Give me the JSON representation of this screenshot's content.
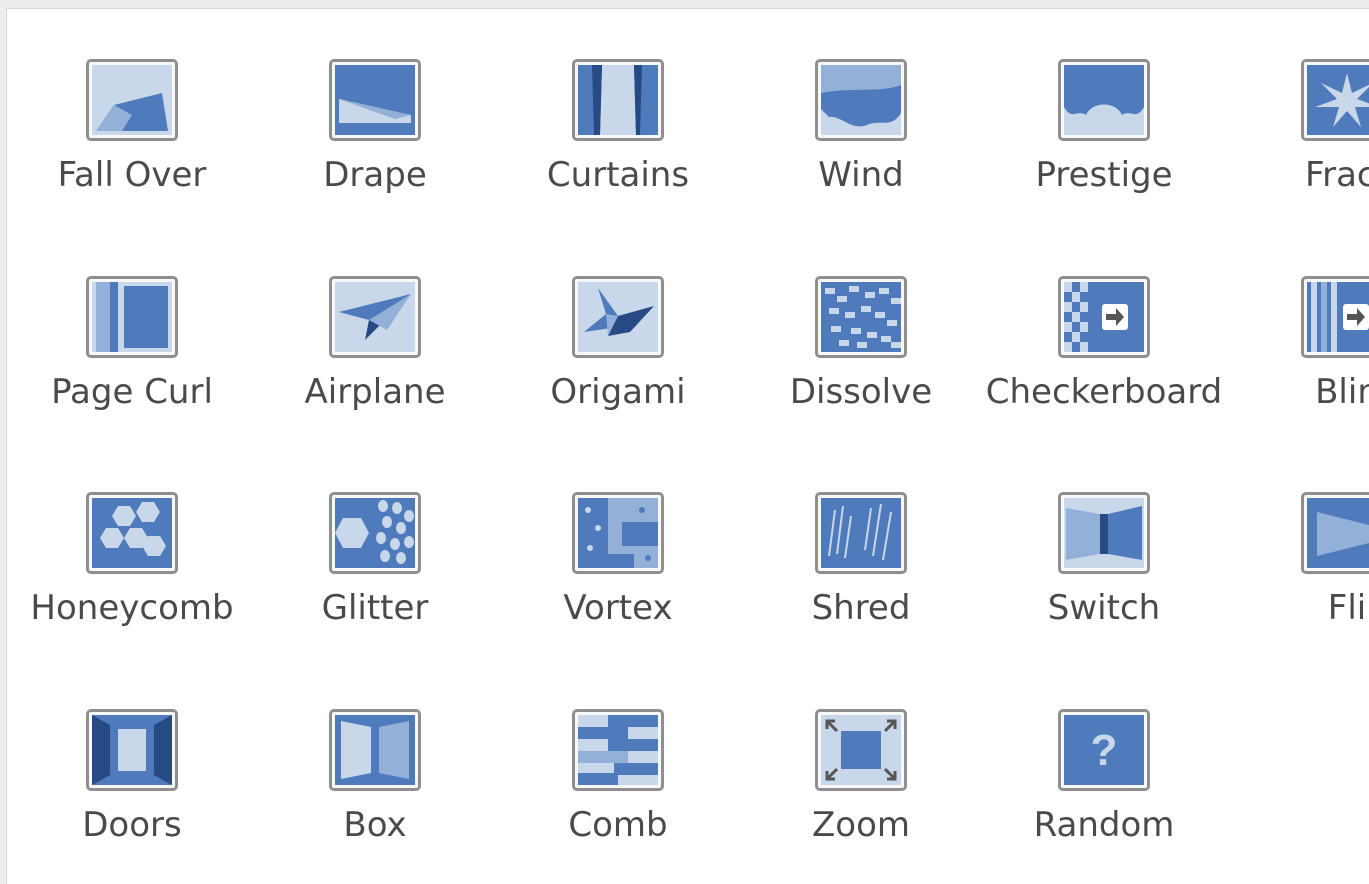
{
  "colors": {
    "icon_bg": "#c9d7ea",
    "icon_main": "#4f7bbd",
    "icon_light": "#93b0d8",
    "icon_dark": "#274a85",
    "label_text": "#4a4a4a",
    "border": "#8f8f8f"
  },
  "transitions": [
    {
      "label": "Fall Over",
      "icon": "fall-over-icon"
    },
    {
      "label": "Drape",
      "icon": "drape-icon"
    },
    {
      "label": "Curtains",
      "icon": "curtains-icon"
    },
    {
      "label": "Wind",
      "icon": "wind-icon"
    },
    {
      "label": "Prestige",
      "icon": "prestige-icon"
    },
    {
      "label": "Fract",
      "icon": "fracture-icon"
    },
    {
      "label": "Page Curl",
      "icon": "page-curl-icon"
    },
    {
      "label": "Airplane",
      "icon": "airplane-icon"
    },
    {
      "label": "Origami",
      "icon": "origami-icon"
    },
    {
      "label": "Dissolve",
      "icon": "dissolve-icon"
    },
    {
      "label": "Checkerboard",
      "icon": "checkerboard-icon"
    },
    {
      "label": "Blin",
      "icon": "blinds-icon"
    },
    {
      "label": "Honeycomb",
      "icon": "honeycomb-icon"
    },
    {
      "label": "Glitter",
      "icon": "glitter-icon"
    },
    {
      "label": "Vortex",
      "icon": "vortex-icon"
    },
    {
      "label": "Shred",
      "icon": "shred-icon"
    },
    {
      "label": "Switch",
      "icon": "switch-icon"
    },
    {
      "label": "Fli",
      "icon": "flip-icon"
    },
    {
      "label": "Doors",
      "icon": "doors-icon"
    },
    {
      "label": "Box",
      "icon": "box-icon"
    },
    {
      "label": "Comb",
      "icon": "comb-icon"
    },
    {
      "label": "Zoom",
      "icon": "zoom-icon"
    },
    {
      "label": "Random",
      "icon": "random-icon"
    }
  ]
}
